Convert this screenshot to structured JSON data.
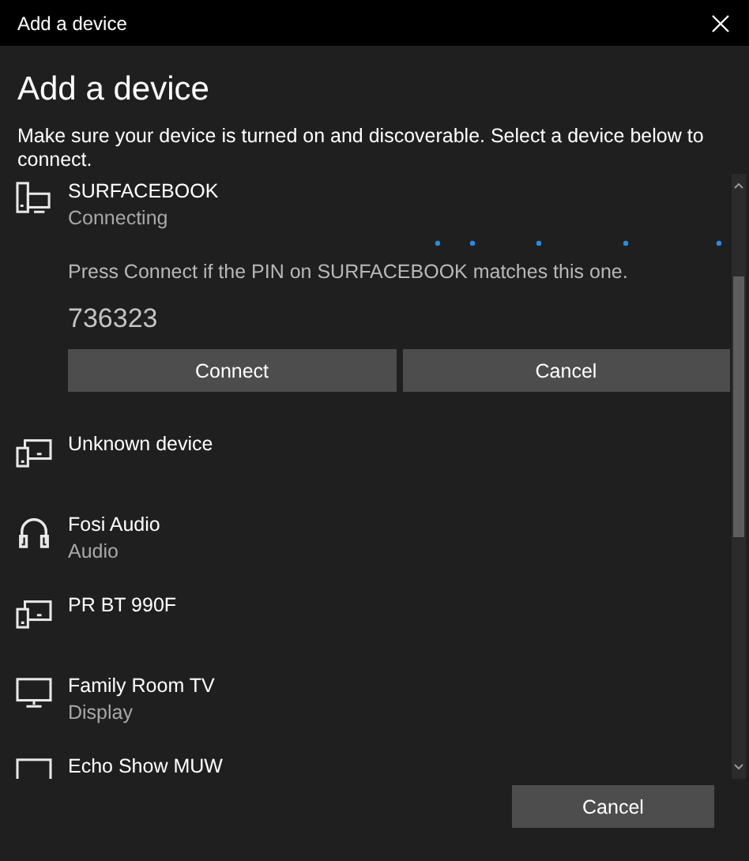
{
  "window": {
    "title": "Add a device"
  },
  "heading": "Add a device",
  "description": "Make sure your device is turned on and discoverable. Select a device below to connect.",
  "devices": [
    {
      "name": "SURFACEBOOK",
      "status": "Connecting",
      "kind": "computer",
      "pairing": {
        "prompt": "Press Connect if the PIN on SURFACEBOOK matches this one.",
        "pin": "736323",
        "buttons": [
          "Connect",
          "Cancel"
        ]
      }
    },
    {
      "name": "Unknown device",
      "kind": "generic"
    },
    {
      "name": "Fosi Audio",
      "status": "Audio",
      "kind": "headphones"
    },
    {
      "name": "PR BT 990F",
      "kind": "generic"
    },
    {
      "name": "Family Room TV",
      "status": "Display",
      "kind": "display"
    },
    {
      "name": "Echo Show MUW",
      "kind": "display"
    }
  ],
  "footer": {
    "button": "Cancel"
  }
}
